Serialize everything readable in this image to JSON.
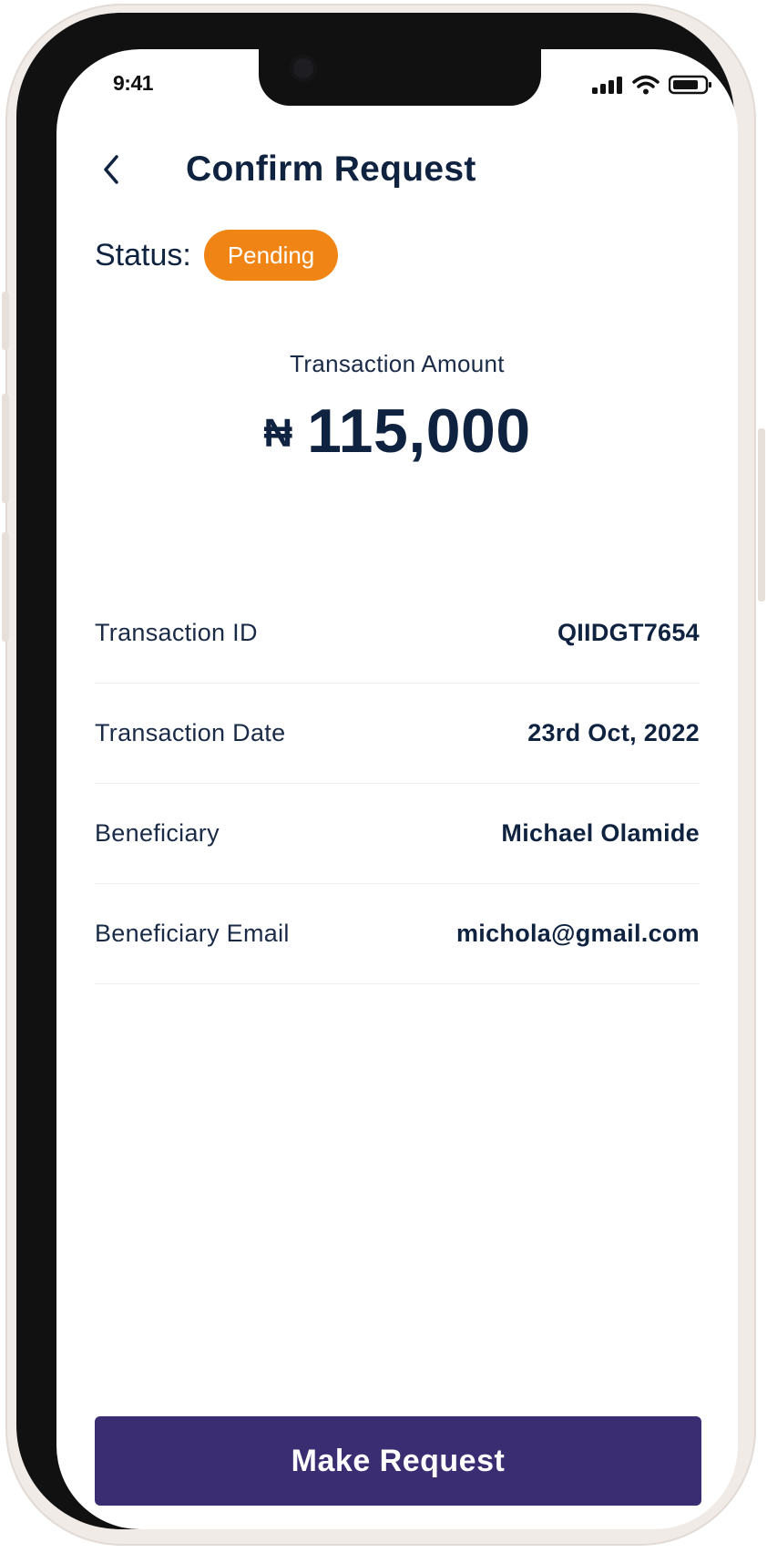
{
  "status_bar": {
    "time": "9:41"
  },
  "header": {
    "title": "Confirm Request",
    "back_icon": "chevron-left-icon"
  },
  "status": {
    "label": "Status:",
    "value": "Pending",
    "color": "#f08414"
  },
  "amount": {
    "label": "Transaction Amount",
    "currency_symbol": "₦",
    "value": "115,000"
  },
  "details": [
    {
      "label": "Transaction ID",
      "value": "QIIDGT7654"
    },
    {
      "label": "Transaction Date",
      "value": "23rd Oct, 2022"
    },
    {
      "label": "Beneficiary",
      "value": "Michael Olamide"
    },
    {
      "label": "Beneficiary Email",
      "value": "michola@gmail.com"
    }
  ],
  "cta": {
    "label": "Make Request",
    "color": "#3b2d72"
  },
  "colors": {
    "text_primary": "#0f2340",
    "background": "#ffffff"
  }
}
